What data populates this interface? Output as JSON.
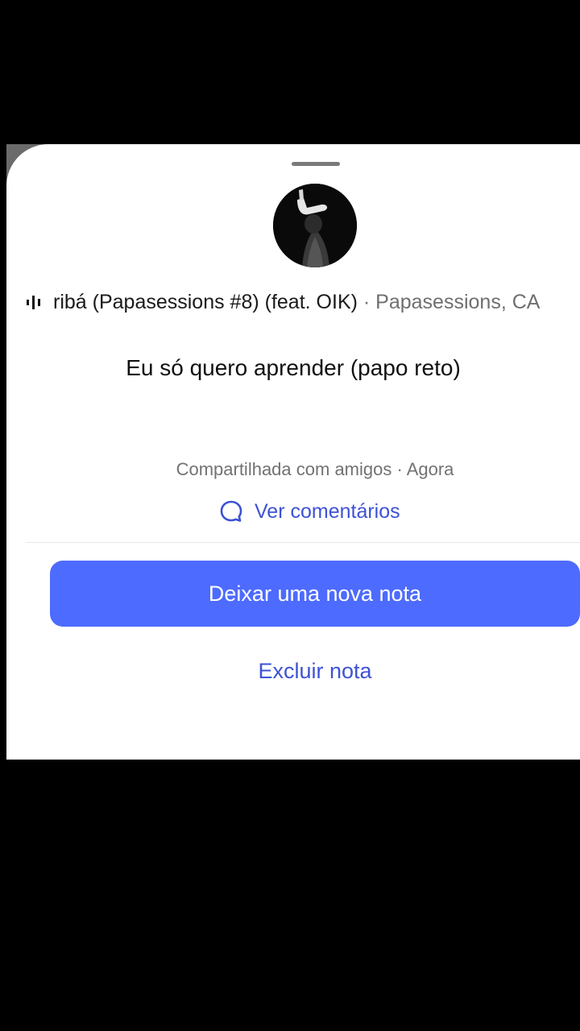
{
  "sheet": {
    "avatar_icon": "profile-photo",
    "track": {
      "playing_icon": "equalizer-icon",
      "title": "ribá (Papasessions #8) (feat. OIK)",
      "separator": " · ",
      "artists": "Papasessions, CA"
    },
    "note": "Eu só quero aprender (papo reto)",
    "meta": "Compartilhada com amigos · Agora",
    "comments": {
      "icon": "comment-bubble-icon",
      "label": "Ver comentários"
    },
    "primary_button": "Deixar uma nova nota",
    "secondary_link": "Excluir nota"
  },
  "colors": {
    "accent": "#4d6bfe",
    "link": "#3d52d5",
    "muted_text": "#727272",
    "background": "#000000",
    "sheet": "#ffffff"
  }
}
